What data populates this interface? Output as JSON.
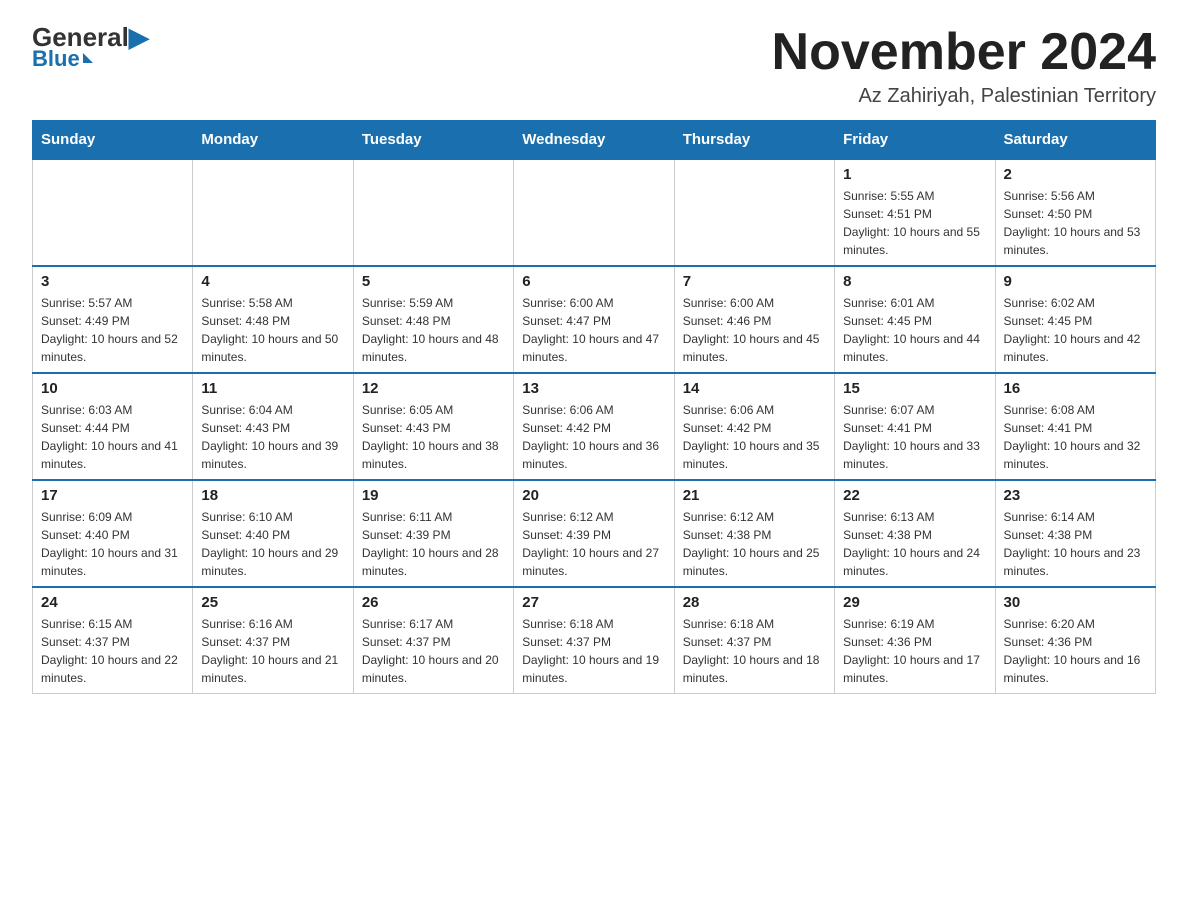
{
  "header": {
    "logo_general": "General",
    "logo_blue": "Blue",
    "month_title": "November 2024",
    "location": "Az Zahiriyah, Palestinian Territory"
  },
  "calendar": {
    "days_of_week": [
      "Sunday",
      "Monday",
      "Tuesday",
      "Wednesday",
      "Thursday",
      "Friday",
      "Saturday"
    ],
    "weeks": [
      [
        {
          "day": "",
          "sunrise": "",
          "sunset": "",
          "daylight": ""
        },
        {
          "day": "",
          "sunrise": "",
          "sunset": "",
          "daylight": ""
        },
        {
          "day": "",
          "sunrise": "",
          "sunset": "",
          "daylight": ""
        },
        {
          "day": "",
          "sunrise": "",
          "sunset": "",
          "daylight": ""
        },
        {
          "day": "",
          "sunrise": "",
          "sunset": "",
          "daylight": ""
        },
        {
          "day": "1",
          "sunrise": "Sunrise: 5:55 AM",
          "sunset": "Sunset: 4:51 PM",
          "daylight": "Daylight: 10 hours and 55 minutes."
        },
        {
          "day": "2",
          "sunrise": "Sunrise: 5:56 AM",
          "sunset": "Sunset: 4:50 PM",
          "daylight": "Daylight: 10 hours and 53 minutes."
        }
      ],
      [
        {
          "day": "3",
          "sunrise": "Sunrise: 5:57 AM",
          "sunset": "Sunset: 4:49 PM",
          "daylight": "Daylight: 10 hours and 52 minutes."
        },
        {
          "day": "4",
          "sunrise": "Sunrise: 5:58 AM",
          "sunset": "Sunset: 4:48 PM",
          "daylight": "Daylight: 10 hours and 50 minutes."
        },
        {
          "day": "5",
          "sunrise": "Sunrise: 5:59 AM",
          "sunset": "Sunset: 4:48 PM",
          "daylight": "Daylight: 10 hours and 48 minutes."
        },
        {
          "day": "6",
          "sunrise": "Sunrise: 6:00 AM",
          "sunset": "Sunset: 4:47 PM",
          "daylight": "Daylight: 10 hours and 47 minutes."
        },
        {
          "day": "7",
          "sunrise": "Sunrise: 6:00 AM",
          "sunset": "Sunset: 4:46 PM",
          "daylight": "Daylight: 10 hours and 45 minutes."
        },
        {
          "day": "8",
          "sunrise": "Sunrise: 6:01 AM",
          "sunset": "Sunset: 4:45 PM",
          "daylight": "Daylight: 10 hours and 44 minutes."
        },
        {
          "day": "9",
          "sunrise": "Sunrise: 6:02 AM",
          "sunset": "Sunset: 4:45 PM",
          "daylight": "Daylight: 10 hours and 42 minutes."
        }
      ],
      [
        {
          "day": "10",
          "sunrise": "Sunrise: 6:03 AM",
          "sunset": "Sunset: 4:44 PM",
          "daylight": "Daylight: 10 hours and 41 minutes."
        },
        {
          "day": "11",
          "sunrise": "Sunrise: 6:04 AM",
          "sunset": "Sunset: 4:43 PM",
          "daylight": "Daylight: 10 hours and 39 minutes."
        },
        {
          "day": "12",
          "sunrise": "Sunrise: 6:05 AM",
          "sunset": "Sunset: 4:43 PM",
          "daylight": "Daylight: 10 hours and 38 minutes."
        },
        {
          "day": "13",
          "sunrise": "Sunrise: 6:06 AM",
          "sunset": "Sunset: 4:42 PM",
          "daylight": "Daylight: 10 hours and 36 minutes."
        },
        {
          "day": "14",
          "sunrise": "Sunrise: 6:06 AM",
          "sunset": "Sunset: 4:42 PM",
          "daylight": "Daylight: 10 hours and 35 minutes."
        },
        {
          "day": "15",
          "sunrise": "Sunrise: 6:07 AM",
          "sunset": "Sunset: 4:41 PM",
          "daylight": "Daylight: 10 hours and 33 minutes."
        },
        {
          "day": "16",
          "sunrise": "Sunrise: 6:08 AM",
          "sunset": "Sunset: 4:41 PM",
          "daylight": "Daylight: 10 hours and 32 minutes."
        }
      ],
      [
        {
          "day": "17",
          "sunrise": "Sunrise: 6:09 AM",
          "sunset": "Sunset: 4:40 PM",
          "daylight": "Daylight: 10 hours and 31 minutes."
        },
        {
          "day": "18",
          "sunrise": "Sunrise: 6:10 AM",
          "sunset": "Sunset: 4:40 PM",
          "daylight": "Daylight: 10 hours and 29 minutes."
        },
        {
          "day": "19",
          "sunrise": "Sunrise: 6:11 AM",
          "sunset": "Sunset: 4:39 PM",
          "daylight": "Daylight: 10 hours and 28 minutes."
        },
        {
          "day": "20",
          "sunrise": "Sunrise: 6:12 AM",
          "sunset": "Sunset: 4:39 PM",
          "daylight": "Daylight: 10 hours and 27 minutes."
        },
        {
          "day": "21",
          "sunrise": "Sunrise: 6:12 AM",
          "sunset": "Sunset: 4:38 PM",
          "daylight": "Daylight: 10 hours and 25 minutes."
        },
        {
          "day": "22",
          "sunrise": "Sunrise: 6:13 AM",
          "sunset": "Sunset: 4:38 PM",
          "daylight": "Daylight: 10 hours and 24 minutes."
        },
        {
          "day": "23",
          "sunrise": "Sunrise: 6:14 AM",
          "sunset": "Sunset: 4:38 PM",
          "daylight": "Daylight: 10 hours and 23 minutes."
        }
      ],
      [
        {
          "day": "24",
          "sunrise": "Sunrise: 6:15 AM",
          "sunset": "Sunset: 4:37 PM",
          "daylight": "Daylight: 10 hours and 22 minutes."
        },
        {
          "day": "25",
          "sunrise": "Sunrise: 6:16 AM",
          "sunset": "Sunset: 4:37 PM",
          "daylight": "Daylight: 10 hours and 21 minutes."
        },
        {
          "day": "26",
          "sunrise": "Sunrise: 6:17 AM",
          "sunset": "Sunset: 4:37 PM",
          "daylight": "Daylight: 10 hours and 20 minutes."
        },
        {
          "day": "27",
          "sunrise": "Sunrise: 6:18 AM",
          "sunset": "Sunset: 4:37 PM",
          "daylight": "Daylight: 10 hours and 19 minutes."
        },
        {
          "day": "28",
          "sunrise": "Sunrise: 6:18 AM",
          "sunset": "Sunset: 4:37 PM",
          "daylight": "Daylight: 10 hours and 18 minutes."
        },
        {
          "day": "29",
          "sunrise": "Sunrise: 6:19 AM",
          "sunset": "Sunset: 4:36 PM",
          "daylight": "Daylight: 10 hours and 17 minutes."
        },
        {
          "day": "30",
          "sunrise": "Sunrise: 6:20 AM",
          "sunset": "Sunset: 4:36 PM",
          "daylight": "Daylight: 10 hours and 16 minutes."
        }
      ]
    ]
  }
}
